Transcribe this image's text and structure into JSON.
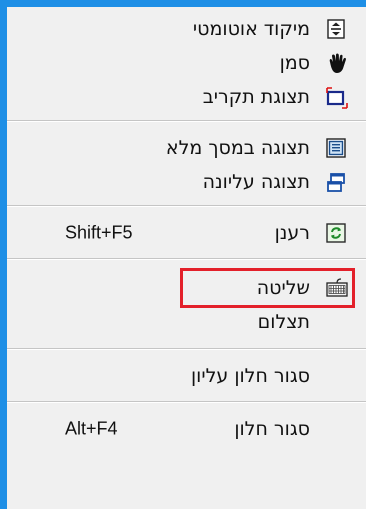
{
  "menu": {
    "items": [
      {
        "label": "מיקוד אוטומטי",
        "shortcut": "",
        "icon": "auto-focus-icon"
      },
      {
        "label": "סמן",
        "shortcut": "",
        "icon": "hand-pointer-icon"
      },
      {
        "label": "תצוגת תקריב",
        "shortcut": "",
        "icon": "zoom-view-icon"
      },
      {
        "label": "תצוגה במסך מלא",
        "shortcut": "",
        "icon": "fullscreen-icon"
      },
      {
        "label": "תצוגה עליונה",
        "shortcut": "",
        "icon": "top-view-icon"
      },
      {
        "label": "רענן",
        "shortcut": "Shift+F5",
        "icon": "refresh-icon"
      },
      {
        "label": "שליטה",
        "shortcut": "",
        "icon": "keyboard-icon",
        "highlighted": true
      },
      {
        "label": "תצלום",
        "shortcut": "",
        "icon": ""
      },
      {
        "label": "סגור חלון עליון",
        "shortcut": "",
        "icon": ""
      },
      {
        "label": "סגור חלון",
        "shortcut": "Alt+F4",
        "icon": ""
      }
    ]
  },
  "colors": {
    "window_border": "#1e8fe6",
    "menu_bg": "#f0f0f0",
    "highlight_box": "#e3202a"
  }
}
